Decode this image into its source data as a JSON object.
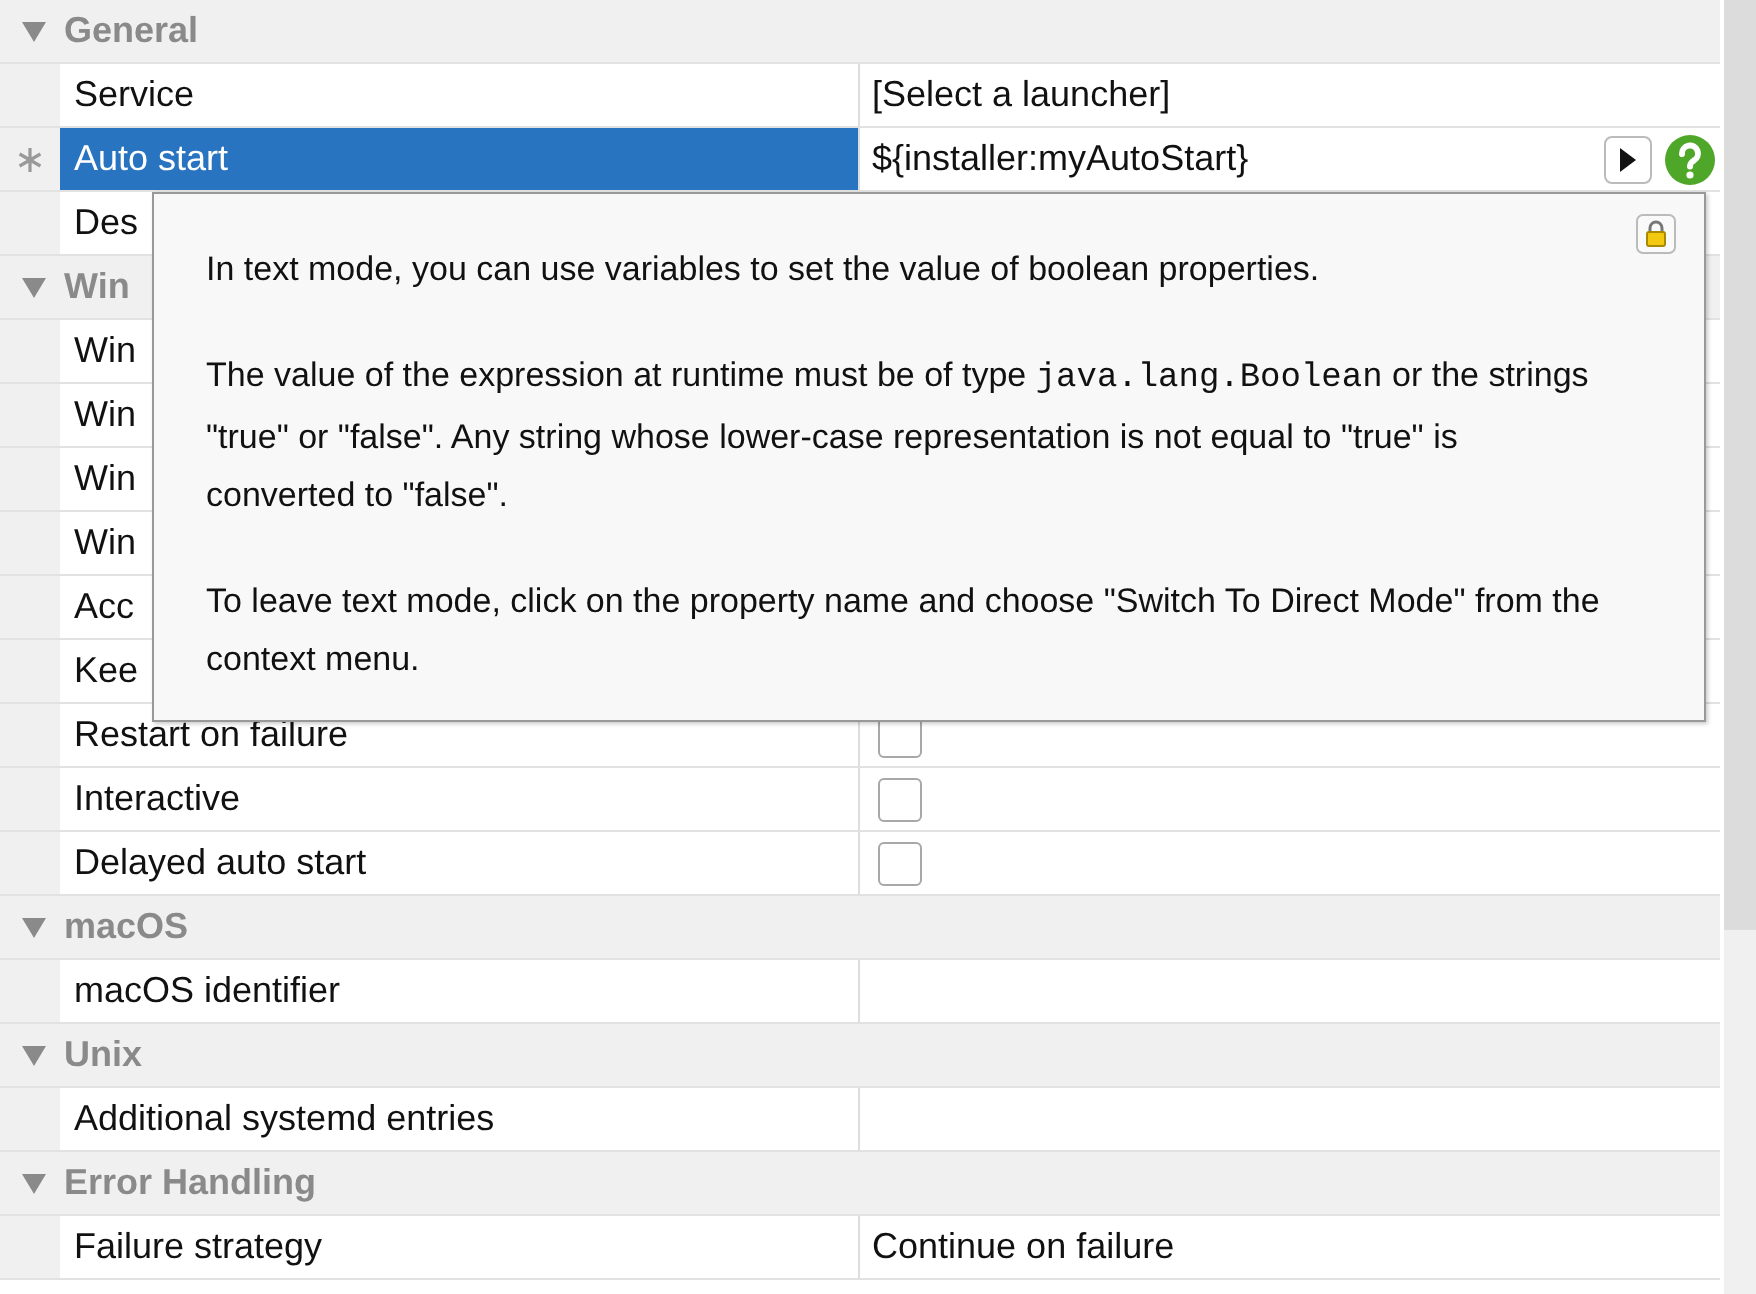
{
  "sections": [
    {
      "title": "General",
      "expanded": true,
      "rows": [
        {
          "name": "Service",
          "kind": "text",
          "value": "[Select a launcher]",
          "selected": false
        },
        {
          "name": "Auto start",
          "kind": "expression",
          "value": "${installer:myAutoStart}",
          "selected": true,
          "modified": true
        },
        {
          "name": "Des",
          "kind": "text",
          "selected": false
        }
      ]
    },
    {
      "title": "Win",
      "expanded": true,
      "rows": [
        {
          "name": "Win",
          "kind": "text",
          "selected": false
        },
        {
          "name": "Win",
          "kind": "text",
          "selected": false
        },
        {
          "name": "Win",
          "kind": "text",
          "selected": false
        },
        {
          "name": "Win",
          "kind": "text",
          "selected": false
        },
        {
          "name": "Acc",
          "kind": "text",
          "selected": false
        },
        {
          "name": "Kee",
          "kind": "text",
          "selected": false
        },
        {
          "name": "Restart on failure",
          "kind": "checkbox",
          "checked": false,
          "selected": false
        },
        {
          "name": "Interactive",
          "kind": "checkbox",
          "checked": false,
          "selected": false
        },
        {
          "name": "Delayed auto start",
          "kind": "checkbox",
          "checked": false,
          "selected": false
        }
      ]
    },
    {
      "title": "macOS",
      "expanded": true,
      "rows": [
        {
          "name": "macOS identifier",
          "kind": "text",
          "selected": false
        }
      ]
    },
    {
      "title": "Unix",
      "expanded": true,
      "rows": [
        {
          "name": "Additional systemd entries",
          "kind": "text",
          "selected": false
        }
      ]
    },
    {
      "title": "Error Handling",
      "expanded": true,
      "rows": [
        {
          "name": "Failure strategy",
          "kind": "text",
          "value": "Continue on failure",
          "selected": false
        }
      ]
    }
  ],
  "tooltip": {
    "paragraphs": [
      [
        {
          "kind": "plain",
          "text": "In text mode, you can use variables to set the value of boolean properties."
        }
      ],
      [
        {
          "kind": "plain",
          "text": "The value of the expression at runtime must be of type "
        },
        {
          "kind": "code",
          "text": "java.lang.Boolean"
        },
        {
          "kind": "plain",
          "text": " or the strings \"true\" or \"false\". Any string whose lower-case representation is not equal to \"true\" is converted to \"false\"."
        }
      ],
      [
        {
          "kind": "plain",
          "text": "To leave text mode, click on the property name and choose \"Switch To Direct Mode\" from the context menu."
        }
      ]
    ]
  }
}
